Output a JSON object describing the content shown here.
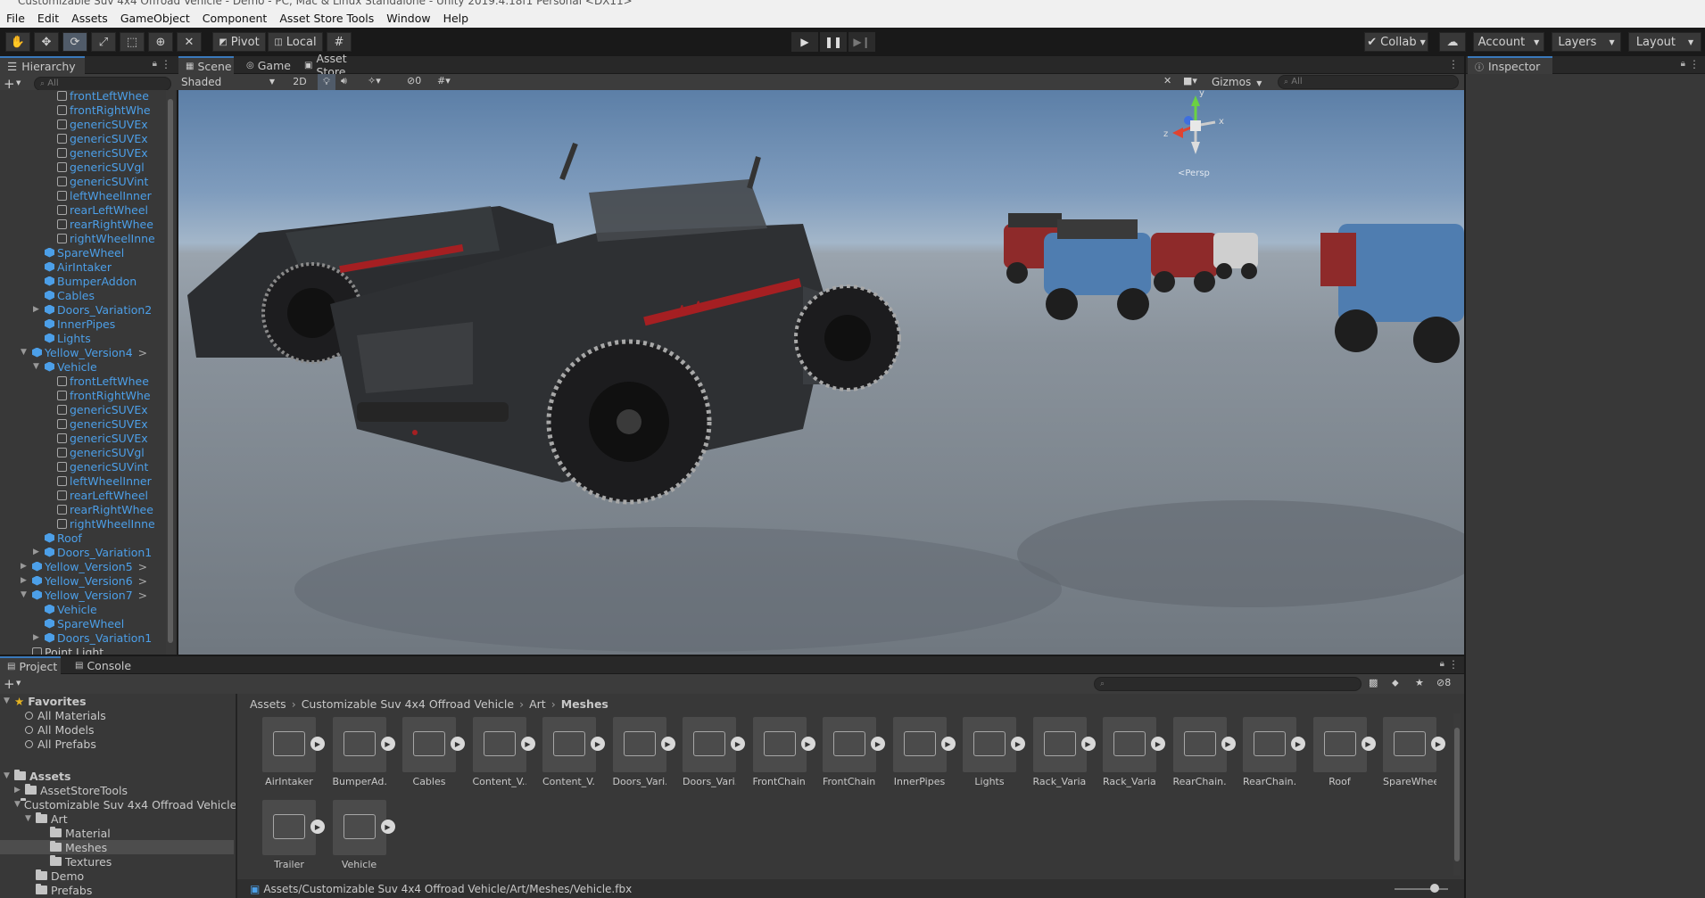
{
  "window": {
    "title": "Customizable Suv 4x4 Offroad Vehicle - Demo - PC, Mac & Linux Standalone - Unity 2019.4.18f1 Personal <DX11>"
  },
  "menu": [
    "File",
    "Edit",
    "Assets",
    "GameObject",
    "Component",
    "Asset Store Tools",
    "Window",
    "Help"
  ],
  "toolbar": {
    "pivot": "Pivot",
    "local": "Local",
    "collab": "Collab",
    "account": "Account",
    "layers": "Layers",
    "layout": "Layout"
  },
  "hierarchy": {
    "tab": "Hierarchy",
    "search_placeholder": "All",
    "rows": [
      {
        "label": "frontLeftWhee",
        "indent": 3,
        "kind": "mesh"
      },
      {
        "label": "frontRightWhe",
        "indent": 3,
        "kind": "mesh"
      },
      {
        "label": "genericSUVEx",
        "indent": 3,
        "kind": "mesh"
      },
      {
        "label": "genericSUVEx",
        "indent": 3,
        "kind": "mesh"
      },
      {
        "label": "genericSUVEx",
        "indent": 3,
        "kind": "mesh"
      },
      {
        "label": "genericSUVgl",
        "indent": 3,
        "kind": "mesh"
      },
      {
        "label": "genericSUVint",
        "indent": 3,
        "kind": "mesh"
      },
      {
        "label": "leftWheelInner",
        "indent": 3,
        "kind": "mesh"
      },
      {
        "label": "rearLeftWheel",
        "indent": 3,
        "kind": "mesh"
      },
      {
        "label": "rearRightWhee",
        "indent": 3,
        "kind": "mesh"
      },
      {
        "label": "rightWheelInne",
        "indent": 3,
        "kind": "mesh"
      },
      {
        "label": "SpareWheel",
        "indent": 2,
        "kind": "prefab"
      },
      {
        "label": "AirIntaker",
        "indent": 2,
        "kind": "prefab"
      },
      {
        "label": "BumperAddon",
        "indent": 2,
        "kind": "prefab"
      },
      {
        "label": "Cables",
        "indent": 2,
        "kind": "prefab"
      },
      {
        "label": "Doors_Variation2",
        "indent": 2,
        "kind": "prefab",
        "arrow": "▶"
      },
      {
        "label": "InnerPipes",
        "indent": 2,
        "kind": "prefab"
      },
      {
        "label": "Lights",
        "indent": 2,
        "kind": "prefab"
      },
      {
        "label": "Yellow_Version4",
        "indent": 1,
        "kind": "prefab",
        "arrow": "▼",
        "chev": ">"
      },
      {
        "label": "Vehicle",
        "indent": 2,
        "kind": "prefab",
        "arrow": "▼"
      },
      {
        "label": "frontLeftWhee",
        "indent": 3,
        "kind": "mesh"
      },
      {
        "label": "frontRightWhe",
        "indent": 3,
        "kind": "mesh"
      },
      {
        "label": "genericSUVEx",
        "indent": 3,
        "kind": "mesh"
      },
      {
        "label": "genericSUVEx",
        "indent": 3,
        "kind": "mesh"
      },
      {
        "label": "genericSUVEx",
        "indent": 3,
        "kind": "mesh"
      },
      {
        "label": "genericSUVgl",
        "indent": 3,
        "kind": "mesh"
      },
      {
        "label": "genericSUVint",
        "indent": 3,
        "kind": "mesh"
      },
      {
        "label": "leftWheelInner",
        "indent": 3,
        "kind": "mesh"
      },
      {
        "label": "rearLeftWheel",
        "indent": 3,
        "kind": "mesh"
      },
      {
        "label": "rearRightWhee",
        "indent": 3,
        "kind": "mesh"
      },
      {
        "label": "rightWheelInne",
        "indent": 3,
        "kind": "mesh"
      },
      {
        "label": "Roof",
        "indent": 2,
        "kind": "prefab"
      },
      {
        "label": "Doors_Variation1",
        "indent": 2,
        "kind": "prefab",
        "arrow": "▶"
      },
      {
        "label": "Yellow_Version5",
        "indent": 1,
        "kind": "prefab",
        "arrow": "▶",
        "chev": ">"
      },
      {
        "label": "Yellow_Version6",
        "indent": 1,
        "kind": "prefab",
        "arrow": "▶",
        "chev": ">"
      },
      {
        "label": "Yellow_Version7",
        "indent": 1,
        "kind": "prefab",
        "arrow": "▼",
        "chev": ">"
      },
      {
        "label": "Vehicle",
        "indent": 2,
        "kind": "prefab"
      },
      {
        "label": "SpareWheel",
        "indent": 2,
        "kind": "prefab"
      },
      {
        "label": "Doors_Variation1",
        "indent": 2,
        "kind": "prefab",
        "arrow": "▶"
      },
      {
        "label": "Point Light",
        "indent": 1,
        "kind": "plain"
      }
    ]
  },
  "scene": {
    "tabs": [
      "Scene",
      "Game",
      "Asset Store"
    ],
    "shading": "Shaded",
    "mode_2d": "2D",
    "hidden_count": "0",
    "gizmos": "Gizmos",
    "search_placeholder": "All",
    "persp_label": "<Persp",
    "axis_x": "x",
    "axis_y": "y",
    "axis_z": "z",
    "car_badge": "4x4"
  },
  "inspector": {
    "tab": "Inspector"
  },
  "project": {
    "tabs": [
      "Project",
      "Console"
    ],
    "hidden_count": "8",
    "favorites_label": "Favorites",
    "favorites": [
      "All Materials",
      "All Models",
      "All Prefabs"
    ],
    "tree": [
      {
        "label": "Assets",
        "indent": 0,
        "arrow": "▼",
        "bold": true
      },
      {
        "label": "AssetStoreTools",
        "indent": 1,
        "arrow": "▶"
      },
      {
        "label": "Customizable Suv 4x4 Offroad Vehicle",
        "indent": 1,
        "arrow": "▼"
      },
      {
        "label": "Art",
        "indent": 2,
        "arrow": "▼"
      },
      {
        "label": "Material",
        "indent": 3
      },
      {
        "label": "Meshes",
        "indent": 3,
        "selected": true
      },
      {
        "label": "Textures",
        "indent": 3
      },
      {
        "label": "Demo",
        "indent": 2
      },
      {
        "label": "Prefabs",
        "indent": 2
      },
      {
        "label": "Scenes",
        "indent": 2
      }
    ],
    "breadcrumb": [
      "Assets",
      "Customizable Suv 4x4 Offroad Vehicle",
      "Art",
      "Meshes"
    ],
    "assets": [
      "AirIntaker",
      "BumperAd...",
      "Cables",
      "Content_V...",
      "Content_V...",
      "Doors_Vari...",
      "Doors_Vari...",
      "FrontChain...",
      "FrontChain...",
      "InnerPipes",
      "Lights",
      "Rack_Varia...",
      "Rack_Varia...",
      "RearChain...",
      "RearChain...",
      "Roof",
      "SpareWheel",
      "Trailer",
      "Vehicle"
    ],
    "status_path": "Assets/Customizable Suv 4x4 Offroad Vehicle/Art/Meshes/Vehicle.fbx"
  },
  "colors": {
    "accent": "#3a79bb",
    "prefab_blue": "#4c9fe8",
    "car_body": "#2e3033",
    "car_stripe": "#a51f22"
  }
}
